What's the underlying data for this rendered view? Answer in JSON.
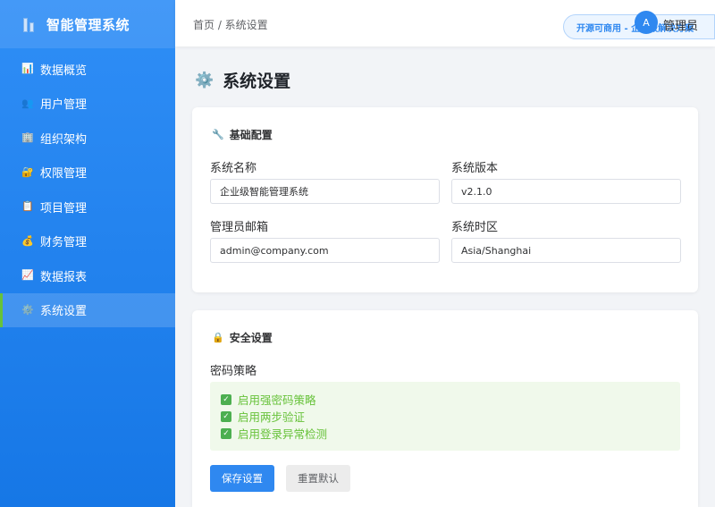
{
  "app": {
    "title": "智能管理系统",
    "logo_icon": "building-icon"
  },
  "sidebar": {
    "items": [
      {
        "label": "数据概览",
        "icon": "bar-chart-icon",
        "glyph": "📊",
        "active": false
      },
      {
        "label": "用户管理",
        "icon": "users-icon",
        "glyph": "👥",
        "active": false
      },
      {
        "label": "组织架构",
        "icon": "office-building-icon",
        "glyph": "🏢",
        "active": false
      },
      {
        "label": "权限管理",
        "icon": "lock-icon",
        "glyph": "🔐",
        "active": false
      },
      {
        "label": "项目管理",
        "icon": "clipboard-icon",
        "glyph": "📋",
        "active": false
      },
      {
        "label": "财务管理",
        "icon": "money-bag-icon",
        "glyph": "💰",
        "active": false
      },
      {
        "label": "数据报表",
        "icon": "line-chart-icon",
        "glyph": "📈",
        "active": false
      },
      {
        "label": "系统设置",
        "icon": "gear-icon",
        "glyph": "⚙️",
        "active": true
      }
    ]
  },
  "header": {
    "breadcrumb": "首页 / 系统设置",
    "badge": "开源可商用 - 企业级解决方案",
    "avatar_letter": "A",
    "username": "管理员"
  },
  "page": {
    "title": "系统设置",
    "title_icon": "⚙️"
  },
  "basic": {
    "title": "基础配置",
    "icon": "🔧",
    "system_name_label": "系统名称",
    "system_name_value": "企业级智能管理系统",
    "version_label": "系统版本",
    "version_value": "v2.1.0",
    "email_label": "管理员邮箱",
    "email_value": "admin@company.com",
    "timezone_label": "系统时区",
    "timezone_value": "Asia/Shanghai"
  },
  "security": {
    "title": "安全设置",
    "icon": "🔒",
    "policy_label": "密码策略",
    "options": [
      {
        "label": "启用强密码策略",
        "checked": true
      },
      {
        "label": "启用两步验证",
        "checked": true
      },
      {
        "label": "启用登录异常检测",
        "checked": true
      }
    ],
    "save_label": "保存设置",
    "reset_label": "重置默认"
  },
  "colors": {
    "primary": "#2f88f0",
    "success": "#67c23a",
    "sidebar": "#1677e6"
  }
}
